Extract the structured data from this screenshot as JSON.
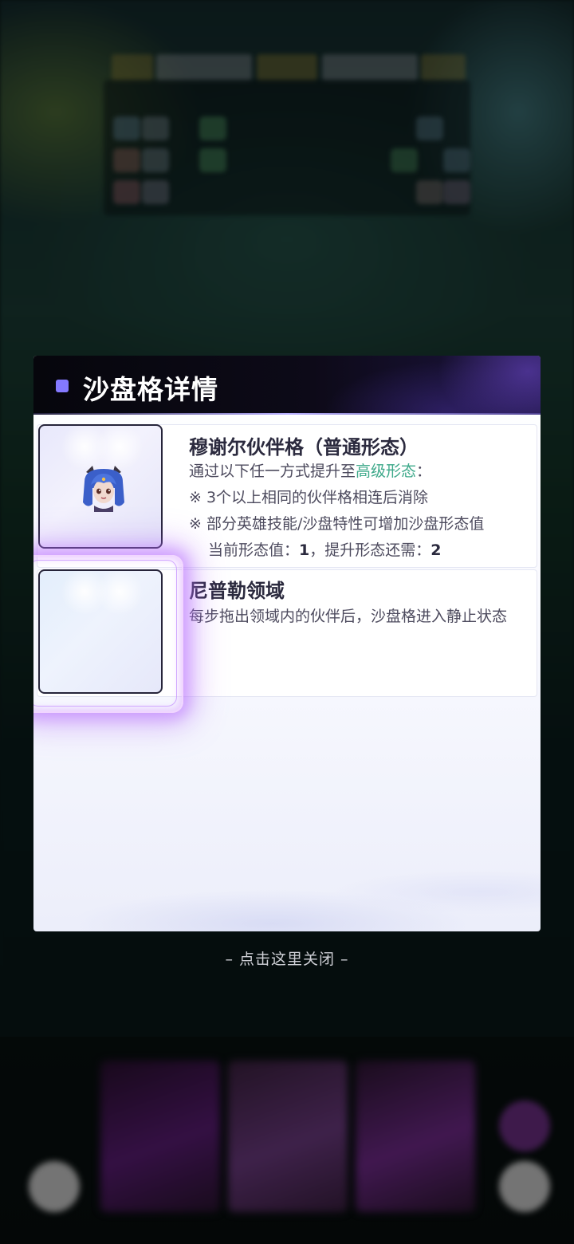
{
  "dialog": {
    "title": "沙盘格详情",
    "accent_color": "#8479ff",
    "items": [
      {
        "name": "穆谢尔伙伴格（普通形态）",
        "desc_prefix": "通过以下任一方式提升至",
        "desc_highlight": "高级形态",
        "desc_suffix": "：",
        "method1": "※ 3个以上相同的伙伴格相连后消除",
        "method2": "※ 部分英雄技能/沙盘特性可增加沙盘形态值",
        "status_label1": "当前形态值：",
        "status_value1": "1",
        "status_label2": "，提升形态还需：",
        "status_value2": "2",
        "icon": "blue-haired-partner-avatar-icon"
      },
      {
        "name": "尼普勒领域",
        "desc": "每步拖出领域内的伙伴后，沙盘格进入静止状态",
        "icon": "empty-domain-cell-icon"
      }
    ]
  },
  "close_hint": "– 点击这里关闭 –"
}
